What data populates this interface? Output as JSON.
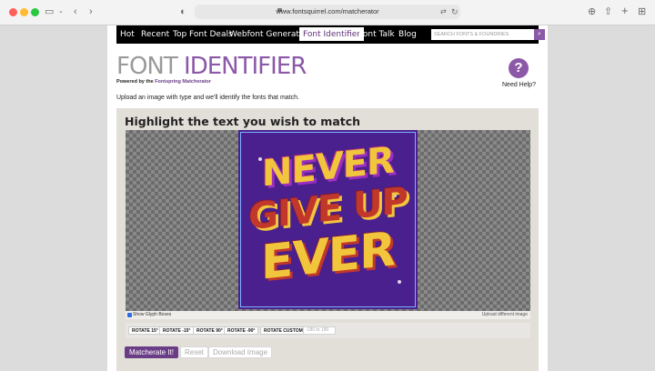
{
  "browser": {
    "url": "www.fontsquirrel.com/matcherator"
  },
  "nav": {
    "items": [
      "Hot",
      "Recent",
      "Top Font Deals",
      "Webfont Generator",
      "Font Identifier",
      "Font Talk",
      "Blog"
    ],
    "active": "Font Identifier",
    "search_placeholder": "SEARCH FONTS & FOUNDRIES"
  },
  "header": {
    "title_part1": "FONT",
    "title_part2": "IDENTIFIER",
    "powered_prefix": "Powered by the",
    "powered_link": "Fontspring Matcherator",
    "help_symbol": "?",
    "help_label": "Need Help?"
  },
  "intro": "Upload an image with type and we'll identify the fonts that match.",
  "panel": {
    "title": "Highlight the text you wish to match",
    "poster_lines": [
      "NEVER",
      "GIVE UP",
      "EVER"
    ],
    "show_glyph_boxes_label": "Show Glyph Boxes",
    "show_glyph_boxes_checked": true,
    "upload_link": "Upload different image"
  },
  "rotate": {
    "buttons": [
      "ROTATE 15°",
      "ROTATE -15°",
      "ROTATE 90°",
      "ROTATE -90°",
      "ROTATE CUSTOM"
    ],
    "custom_placeholder": "-180 to 180"
  },
  "actions": {
    "matcherate": "Matcherate It!",
    "reset": "Reset",
    "download": "Download Image"
  },
  "colors": {
    "accent": "#8c58a8",
    "button": "#6a3d86",
    "poster_bg": "#4a1f8e",
    "poster_yellow": "#f1c63d",
    "poster_red": "#c1382b"
  }
}
